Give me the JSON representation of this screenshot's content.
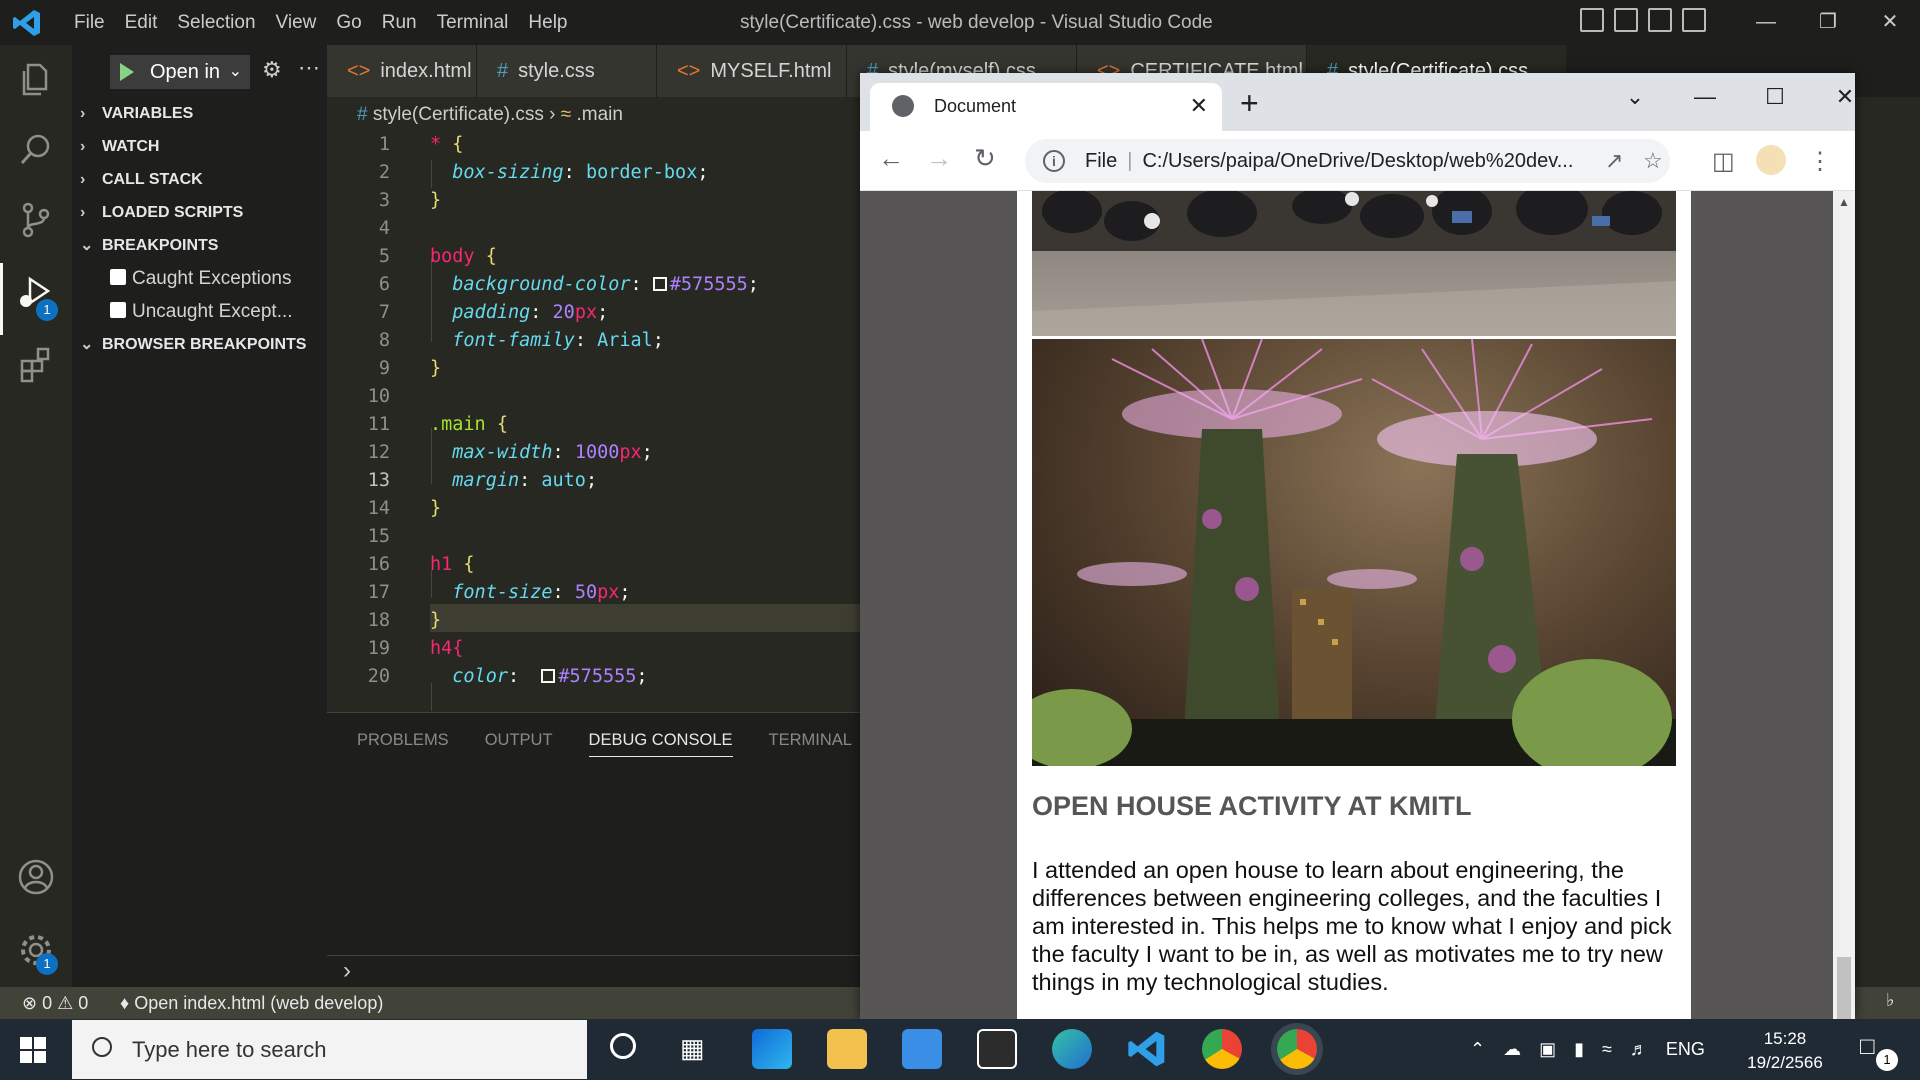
{
  "window": {
    "title": "style(Certificate).css - web develop - Visual Studio Code",
    "menu": [
      "File",
      "Edit",
      "Selection",
      "View",
      "Go",
      "Run",
      "Terminal",
      "Help"
    ]
  },
  "activity": {
    "debug_badge": "1",
    "settings_badge": "1"
  },
  "sidebar": {
    "run_label": "Open in",
    "sections": {
      "variables": "VARIABLES",
      "watch": "WATCH",
      "call_stack": "CALL STACK",
      "loaded_scripts": "LOADED SCRIPTS",
      "breakpoints": "BREAKPOINTS",
      "browser_breakpoints": "BROWSER BREAKPOINTS"
    },
    "breakpoints": [
      "Caught Exceptions",
      "Uncaught Except..."
    ]
  },
  "tabs": [
    "index.html",
    "style.css",
    "MYSELF.html",
    "style(myself).css",
    "CERTIFICATE.html",
    "style(Certificate).css"
  ],
  "breadcrumb": {
    "file": "style(Certificate).css",
    "symbol": ".main"
  },
  "code": {
    "lines": [
      "1",
      "2",
      "3",
      "4",
      "5",
      "6",
      "7",
      "8",
      "9",
      "10",
      "11",
      "12",
      "13",
      "14",
      "15",
      "16",
      "17",
      "18",
      "19",
      "20"
    ],
    "l1_sel": "*",
    "l1_brace": "{",
    "l2_prop": "box-sizing",
    "l2_val": "border-box",
    "l5_sel": "body",
    "l6_prop": "background-color",
    "l6_hex": "#575555",
    "l7_prop": "padding",
    "l7_num": "20",
    "l7_unit": "px",
    "l8_prop": "font-family",
    "l8_val": "Arial",
    "l11_sel": ".main",
    "l12_prop": "max-width",
    "l12_num": "1000",
    "l12_unit": "px",
    "l13_prop": "margin",
    "l13_val": "auto",
    "l16_sel": "h1",
    "l17_prop": "font-size",
    "l17_num": "50",
    "l17_unit": "px",
    "l19_sel": "h4{",
    "l20_prop": "color",
    "l20_hex": "#575555",
    "close_brace": "}"
  },
  "panel": {
    "tabs": [
      "PROBLEMS",
      "OUTPUT",
      "DEBUG CONSOLE",
      "TERMINAL"
    ],
    "active": "DEBUG CONSOLE"
  },
  "status": {
    "errors": "0",
    "warnings": "0",
    "launch": "Open index.html (web develop)"
  },
  "browser": {
    "tab_title": "Document",
    "file_label": "File",
    "url": "C:/Users/paipa/OneDrive/Desktop/web%20dev...",
    "page": {
      "heading": "OPEN HOUSE ACTIVITY AT KMITL",
      "paragraph": "I attended an open house to learn about engineering, the differences between engineering colleges, and the faculties I am interested in. This helps me to know what I enjoy and pick the faculty I want to be in, as well as motivates me to try new things in my technological studies."
    }
  },
  "taskbar": {
    "search_placeholder": "Type here to search",
    "lang": "ENG",
    "time": "15:28",
    "date": "19/2/2566",
    "notif_badge": "1"
  },
  "colors": {
    "accent": "#0e70c0",
    "page_bg": "#575555",
    "editor_bg": "#272822"
  }
}
